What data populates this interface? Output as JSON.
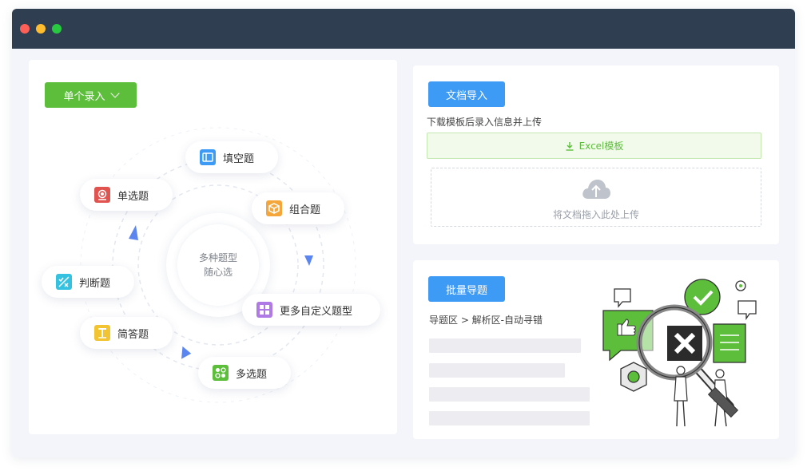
{
  "window": {
    "controls": [
      "close",
      "minimize",
      "maximize"
    ]
  },
  "left_panel": {
    "entry_button": {
      "label": "单个录入",
      "icon": "chevron-down-icon"
    },
    "center": {
      "line1": "多种题型",
      "line2": "随心选"
    },
    "question_types": [
      {
        "key": "fill",
        "label": "填空题",
        "icon": "fill-blank-icon",
        "color": "#3d9af5"
      },
      {
        "key": "single",
        "label": "单选题",
        "icon": "single-choice-icon",
        "color": "#e0534f"
      },
      {
        "key": "combo",
        "label": "组合题",
        "icon": "box-icon",
        "color": "#f5a63a"
      },
      {
        "key": "judge",
        "label": "判断题",
        "icon": "true-false-icon",
        "color": "#35c2e0"
      },
      {
        "key": "custom",
        "label": "更多自定义题型",
        "icon": "grid-icon",
        "color": "#b07ae6"
      },
      {
        "key": "short",
        "label": "简答题",
        "icon": "text-t-icon",
        "color": "#f2c431"
      },
      {
        "key": "multi",
        "label": "多选题",
        "icon": "multi-choice-icon",
        "color": "#5cbe3a"
      }
    ]
  },
  "doc_import": {
    "button": "文档导入",
    "hint": "下载模板后录入信息并上传",
    "excel_label": "Excel模板",
    "dropzone_text": "将文档拖入此处上传"
  },
  "batch_import": {
    "button": "批量导题",
    "steps": "导题区 > 解析区-自动寻错"
  },
  "colors": {
    "green": "#5cbe3a",
    "blue": "#3d9af5",
    "titlebar": "#2f3e51"
  }
}
